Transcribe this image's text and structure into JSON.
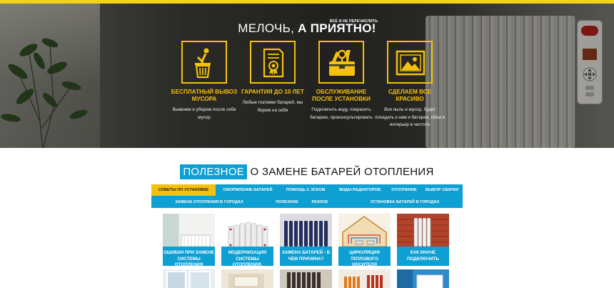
{
  "hero": {
    "title_normal": "МЕЛОЧЬ, ",
    "title_bold": "А ПРИЯТНО!",
    "title_tiny": "ВСЁ И НЕ ПЕРЕЧИСЛИТЬ",
    "features": [
      {
        "icon": "trash-can-icon",
        "title": "БЕСПЛАТНЫЙ ВЫВОЗ МУСОРА",
        "desc": "Вывезем и уберем после себя мусор"
      },
      {
        "icon": "certificate-icon",
        "title": "ГАРАНТИЯ ДО 10 ЛЕТ",
        "desc": "Любые поломки батарей, мы берем на себя"
      },
      {
        "icon": "toolbox-icon",
        "title": "ОБСЛУЖИВАНИЕ ПОСЛЕ УСТАНОВКИ",
        "desc": "Подключить воду, покрасить батарею, проконсультировать"
      },
      {
        "icon": "picture-icon",
        "title": "СДЕЛАЕМ ВСЕ КРАСИВО",
        "desc": "Вся пыль и мусор, будет попадать к нам и батарея, обои и интерьер в чистоте"
      }
    ]
  },
  "section": {
    "title_highlight": "ПОЛЕЗНОЕ",
    "title_rest": " О ЗАМЕНЕ БАТАРЕЙ ОТОПЛЕНИЯ"
  },
  "tabs": {
    "row1": [
      "СОВЕТЫ ПО УСТАНОВКЕ",
      "ОФОРМЛЕНИЕ БАТАРЕЙ",
      "ПОМОЩЬ С ЭСКОМ",
      "ВИДЫ РАДИАТОРОВ",
      "ОТОПЛЕНИЕ",
      "ВЫБОР СВАРКИ"
    ],
    "row2": [
      "ЗАМЕНА ОТОПЛЕНИЯ В ГОРОДАХ",
      "ПОЛЕЗНОЕ",
      "РАЗНОЕ",
      "УСТАНОВКА БАТАРЕЙ В ГОРОДАХ"
    ],
    "active": "СОВЕТЫ ПО УСТАНОВКЕ"
  },
  "cards": [
    {
      "caption": "ОШИБКИ ПРИ ЗАМЕНЕ СИСТЕМЫ ОТОПЛЕНИЯ"
    },
    {
      "caption": "МОДЕРНИЗАЦИЯ СИСТЕМЫ ОТОПЛЕНИЯ."
    },
    {
      "caption": "ЗАМЕНА БАТАРЕЙ - В ЧЕМ ПРИЧИНА?"
    },
    {
      "caption": "ЦИРКУЛЯЦИЯ ТЕПЛОВОГО НОСИТЕЛЯ"
    },
    {
      "caption": "КАК ИНАЧЕ ПОДКЛЮЧИТЬ"
    }
  ],
  "colors": {
    "accent_yellow": "#f3c10e",
    "accent_blue": "#0e9fd3"
  }
}
